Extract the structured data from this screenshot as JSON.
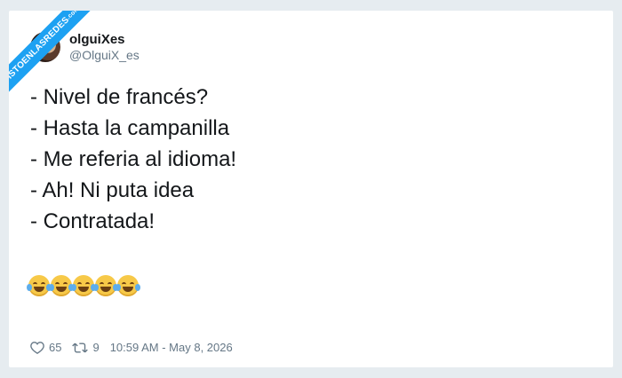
{
  "watermark": {
    "text": "VISTOENLASREDES",
    "suffix": ".com"
  },
  "tweet": {
    "display_name": "olguiXes",
    "handle": "@OlguiX_es",
    "lines": [
      "- Nivel de francés?",
      "- Hasta la campanilla",
      "- Me referia al idioma!",
      "- Ah! Ni puta idea",
      "- Contratada!"
    ],
    "emoji": [
      "😂",
      "😂",
      "😂",
      "😂",
      "😂"
    ],
    "likes": "65",
    "retweets": "9",
    "timestamp": "10:59 AM - May 8, 2026"
  },
  "icons": {
    "like": "heart-icon",
    "retweet": "retweet-icon",
    "emoji": "tears-of-joy-emoji"
  },
  "colors": {
    "background": "#e6ecf0",
    "ribbon": "#1da1f2",
    "text": "#14171a",
    "muted": "#657786"
  }
}
